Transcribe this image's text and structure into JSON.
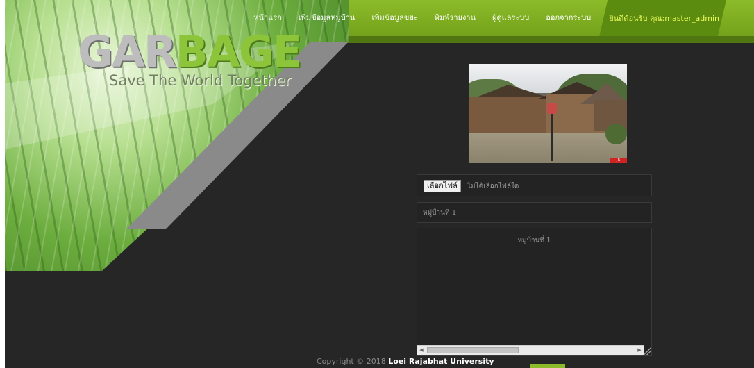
{
  "logo": {
    "word_part1": "GAR",
    "word_part2": "BAGE",
    "tagline": "Save The World Together"
  },
  "nav": {
    "items": [
      "หน้าแรก",
      "เพิ่มข้อมูลหมู่บ้าน",
      "เพิ่มข้อมูลขยะ",
      "พิมพ์รายงาน",
      "ผู้ดูแลระบบ",
      "ออกจากระบบ"
    ],
    "welcome": "ยินดีต้อนรับ คุณ:master_admin"
  },
  "photo": {
    "badge": "JR TRAVEL"
  },
  "form": {
    "file_button": "เลือกไฟล์",
    "file_status": "ไม่ได้เลือกไฟล์ใด",
    "village_value": "หมู่บ้านที่ 1",
    "description_value": "หมู่บ้านที่ 1"
  },
  "footer": {
    "copyright": "Copyright © 2018",
    "org": "Loei Rajabhat University"
  },
  "colors": {
    "accent": "#8cbb2a",
    "welcome_text": "#e7f75a",
    "background": "#262626"
  },
  "icons": [
    "scroll-left-arrow-icon",
    "scroll-right-arrow-icon",
    "resize-handle-icon"
  ]
}
